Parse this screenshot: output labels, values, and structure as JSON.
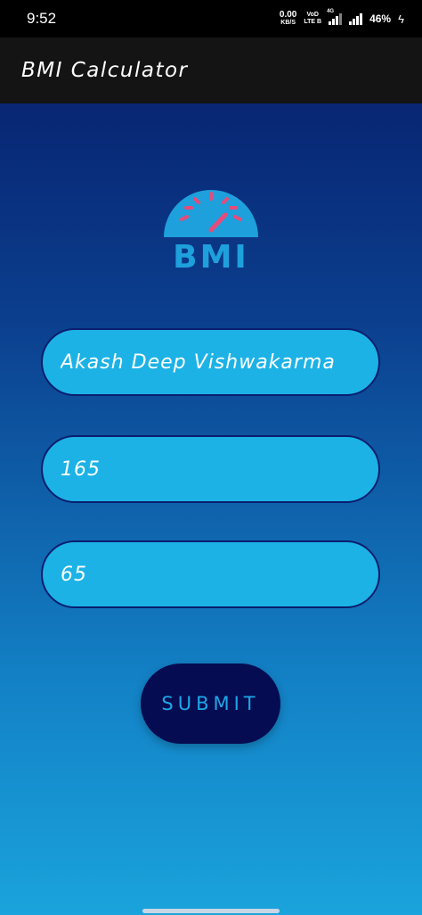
{
  "status_bar": {
    "time": "9:52",
    "net_speed_value": "0.00",
    "net_speed_unit": "KB/S",
    "volte_top": "VoD",
    "volte_bottom": "LTE B",
    "network_tag": "4G",
    "battery": "46%",
    "charging_icon": "lightning-bolt-icon"
  },
  "app_bar": {
    "title": "BMI Calculator"
  },
  "logo": {
    "text": "BMI",
    "colors": {
      "dial": "#1ea0dc",
      "ticks": "#e64b7a",
      "text": "#1ea0dc"
    }
  },
  "form": {
    "name_value": "Akash Deep Vishwakarma",
    "height_value": "165",
    "weight_value": "65",
    "submit_label": "SUBMIT"
  },
  "colors": {
    "field_bg": "#1cb2e6",
    "field_border": "#0a1e6e",
    "button_bg": "#050c52",
    "button_text": "#1ea7e6",
    "app_bar_bg": "#141414"
  }
}
